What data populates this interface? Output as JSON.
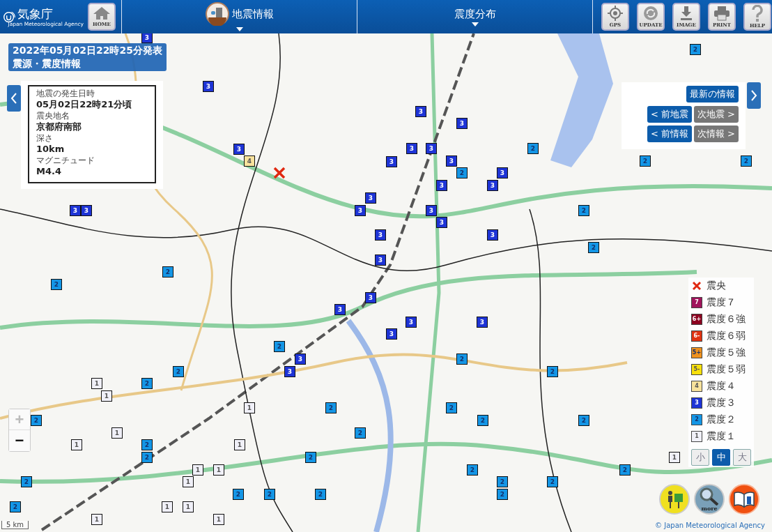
{
  "header": {
    "logo": {
      "name": "気象庁",
      "subtitle": "Japan Meteorological Agency"
    },
    "home_button": "HOME",
    "menus": [
      {
        "label": "地震情報",
        "kind": "icon"
      },
      {
        "label": "震度分布",
        "kind": "plain"
      }
    ],
    "tools": [
      {
        "label": "GPS",
        "kind": "gps"
      },
      {
        "label": "UPDATE",
        "kind": "update"
      },
      {
        "label": "IMAGE"
      },
      {
        "label": "PRINT",
        "kind": "print"
      },
      {
        "label": "HELP",
        "kind": "help"
      }
    ]
  },
  "title": [
    "2022年05月02日22時25分発表",
    "震源・震度情報"
  ],
  "info": [
    {
      "label": "地震の発生日時",
      "value": "05月02日22時21分頃"
    },
    {
      "label": "震央地名",
      "value": "京都府南部"
    },
    {
      "label": "深さ",
      "value": "10km"
    },
    {
      "label": "マグニチュード",
      "value": "M4.4"
    }
  ],
  "nav": {
    "latest": "最新の情報",
    "buttons": [
      {
        "label": "< 前地震",
        "disabled": false
      },
      {
        "label": "次地震 >",
        "disabled": true
      },
      {
        "label": "< 前情報",
        "disabled": false
      },
      {
        "label": "次情報 >",
        "disabled": true
      }
    ]
  },
  "legend": [
    {
      "kind": "epicenter",
      "label": "震央"
    },
    {
      "kind": "badge",
      "badge": "7",
      "label": "震度７",
      "color": "#a0145c"
    },
    {
      "kind": "badge",
      "badge": "6+",
      "label": "震度６強",
      "color": "#8c0020"
    },
    {
      "kind": "badge",
      "badge": "6-",
      "label": "震度６弱",
      "color": "#e03312"
    },
    {
      "kind": "badge",
      "badge": "5+",
      "label": "震度５強",
      "color": "#f0921e"
    },
    {
      "kind": "badge",
      "badge": "5-",
      "label": "震度５弱",
      "color": "#f8e00c"
    },
    {
      "kind": "badge",
      "badge": "4",
      "label": "震度４",
      "color": "#f8e29c"
    },
    {
      "kind": "badge",
      "badge": "3",
      "label": "震度３",
      "color": "#1e34d6"
    },
    {
      "kind": "badge",
      "badge": "2",
      "label": "震度２",
      "color": "#1496e6"
    },
    {
      "kind": "badge",
      "badge": "1",
      "label": "震度１",
      "color": "#f0f0f8"
    }
  ],
  "size_buttons": [
    {
      "label": "小",
      "selected": false
    },
    {
      "label": "中",
      "selected": true
    },
    {
      "label": "大",
      "selected": false
    }
  ],
  "zoom": [
    {
      "label": "+",
      "disabled": true
    },
    {
      "label": "−",
      "disabled": false
    }
  ],
  "bottom_buttons": [
    {
      "kind": "guide"
    },
    {
      "kind": "more",
      "label": "more"
    },
    {
      "kind": "info"
    }
  ],
  "scale": "5 km",
  "copyright": "© Japan Meteorological Agency",
  "markers": [
    {
      "intensity": "3",
      "color": "#1e34d6"
    },
    {
      "intensity": "2",
      "color": "#1496e6"
    },
    {
      "intensity": "3",
      "color": "#1e34d6"
    },
    {
      "intensity": "3",
      "color": "#1e34d6"
    },
    {
      "intensity": "3",
      "color": "#1e34d6"
    },
    {
      "intensity": "3",
      "color": "#1e34d6"
    },
    {
      "intensity": "3",
      "color": "#1e34d6"
    },
    {
      "intensity": "3",
      "color": "#1e34d6"
    },
    {
      "intensity": "2",
      "color": "#1496e6"
    },
    {
      "intensity": "4",
      "color": "#f8e29c"
    },
    {
      "intensity": "3",
      "color": "#1e34d6"
    },
    {
      "intensity": "3",
      "color": "#1e34d6"
    },
    {
      "intensity": "2",
      "color": "#1496e6"
    },
    {
      "intensity": "2",
      "color": "#1496e6"
    },
    {
      "intensity": "2",
      "color": "#1496e6"
    },
    {
      "intensity": "3",
      "color": "#1e34d6"
    },
    {
      "intensity": "3",
      "color": "#1e34d6"
    },
    {
      "intensity": "3",
      "color": "#1e34d6"
    },
    {
      "intensity": "3",
      "color": "#1e34d6"
    },
    {
      "intensity": "3",
      "color": "#1e34d6"
    },
    {
      "intensity": "3",
      "color": "#1e34d6"
    },
    {
      "intensity": "3",
      "color": "#1e34d6"
    },
    {
      "intensity": "3",
      "color": "#1e34d6"
    },
    {
      "intensity": "2",
      "color": "#1496e6"
    },
    {
      "intensity": "3",
      "color": "#1e34d6"
    },
    {
      "intensity": "3",
      "color": "#1e34d6"
    },
    {
      "intensity": "3",
      "color": "#1e34d6"
    },
    {
      "intensity": "2",
      "color": "#1496e6"
    },
    {
      "intensity": "3",
      "color": "#1e34d6"
    },
    {
      "intensity": "2",
      "color": "#1496e6"
    },
    {
      "intensity": "2",
      "color": "#1496e6"
    },
    {
      "intensity": "3",
      "color": "#1e34d6"
    },
    {
      "intensity": "3",
      "color": "#1e34d6"
    },
    {
      "intensity": "3",
      "color": "#1e34d6"
    },
    {
      "intensity": "3",
      "color": "#1e34d6"
    },
    {
      "intensity": "3",
      "color": "#1e34d6"
    },
    {
      "intensity": "2",
      "color": "#1496e6"
    },
    {
      "intensity": "3",
      "color": "#1e34d6"
    },
    {
      "intensity": "2",
      "color": "#1496e6"
    },
    {
      "intensity": "2",
      "color": "#1496e6"
    },
    {
      "intensity": "3",
      "color": "#1e34d6"
    },
    {
      "intensity": "2",
      "color": "#1496e6"
    },
    {
      "intensity": "1",
      "color": "#f0f0f8"
    },
    {
      "intensity": "2",
      "color": "#1496e6"
    },
    {
      "intensity": "1",
      "color": "#f0f0f8"
    },
    {
      "intensity": "1",
      "color": "#f0f0f8"
    },
    {
      "intensity": "2",
      "color": "#1496e6"
    },
    {
      "intensity": "2",
      "color": "#1496e6"
    },
    {
      "intensity": "2",
      "color": "#1496e6"
    },
    {
      "intensity": "2",
      "color": "#1496e6"
    },
    {
      "intensity": "2",
      "color": "#1496e6"
    },
    {
      "intensity": "1",
      "color": "#f0f0f8"
    },
    {
      "intensity": "2",
      "color": "#1496e6"
    },
    {
      "intensity": "1",
      "color": "#f0f0f8"
    },
    {
      "intensity": "2",
      "color": "#1496e6"
    },
    {
      "intensity": "1",
      "color": "#f0f0f8"
    },
    {
      "intensity": "2",
      "color": "#1496e6"
    },
    {
      "intensity": "2",
      "color": "#1496e6"
    },
    {
      "intensity": "1",
      "color": "#f0f0f8"
    },
    {
      "intensity": "1",
      "color": "#f0f0f8"
    },
    {
      "intensity": "1",
      "color": "#f0f0f8"
    },
    {
      "intensity": "2",
      "color": "#1496e6"
    },
    {
      "intensity": "2",
      "color": "#1496e6"
    },
    {
      "intensity": "2",
      "color": "#1496e6"
    },
    {
      "intensity": "1",
      "color": "#f0f0f8"
    },
    {
      "intensity": "2",
      "color": "#1496e6"
    },
    {
      "intensity": "2",
      "color": "#1496e6"
    },
    {
      "intensity": "2",
      "color": "#1496e6"
    },
    {
      "intensity": "2",
      "color": "#1496e6"
    },
    {
      "intensity": "2",
      "color": "#1496e6"
    },
    {
      "intensity": "2",
      "color": "#1496e6"
    },
    {
      "intensity": "2",
      "color": "#1496e6"
    },
    {
      "intensity": "1",
      "color": "#f0f0f8"
    },
    {
      "intensity": "1",
      "color": "#f0f0f8"
    },
    {
      "intensity": "1",
      "color": "#f0f0f8"
    },
    {
      "intensity": "1",
      "color": "#f0f0f8"
    }
  ]
}
